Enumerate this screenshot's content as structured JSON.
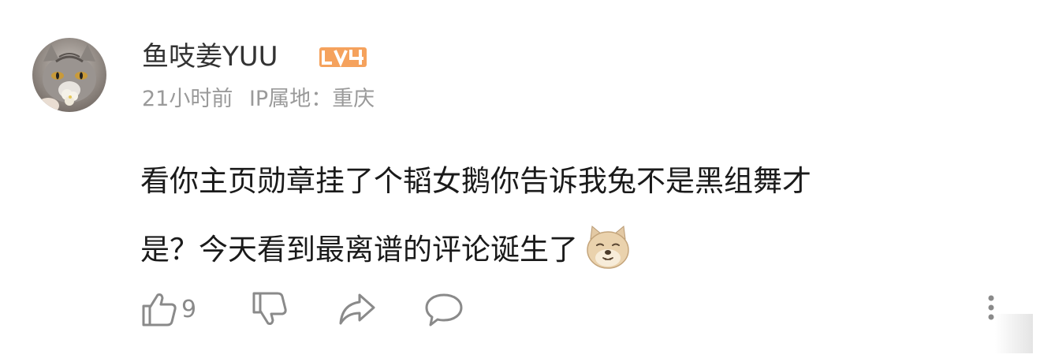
{
  "comment": {
    "username": "鱼吱姜YUU",
    "level": "LV4",
    "time": "21小时前",
    "ip_location": "IP属地：重庆",
    "content_line1": "看你主页勋章挂了个韬女鹅你告诉我兔不是黑组舞才",
    "content_line2": "是？今天看到最离谱的评论诞生了",
    "emoji": "doge-dog-emoji",
    "likes": "9"
  },
  "colors": {
    "level_badge": "#f5a25d",
    "meta_text": "#9a9a9a",
    "icon_stroke": "#8a8a8a",
    "content_text": "#1a1a1a"
  },
  "icons": {
    "like": "thumbs-up-icon",
    "dislike": "thumbs-down-icon",
    "share": "share-arrow-icon",
    "reply": "chat-bubble-icon",
    "more": "vertical-dots-icon"
  }
}
